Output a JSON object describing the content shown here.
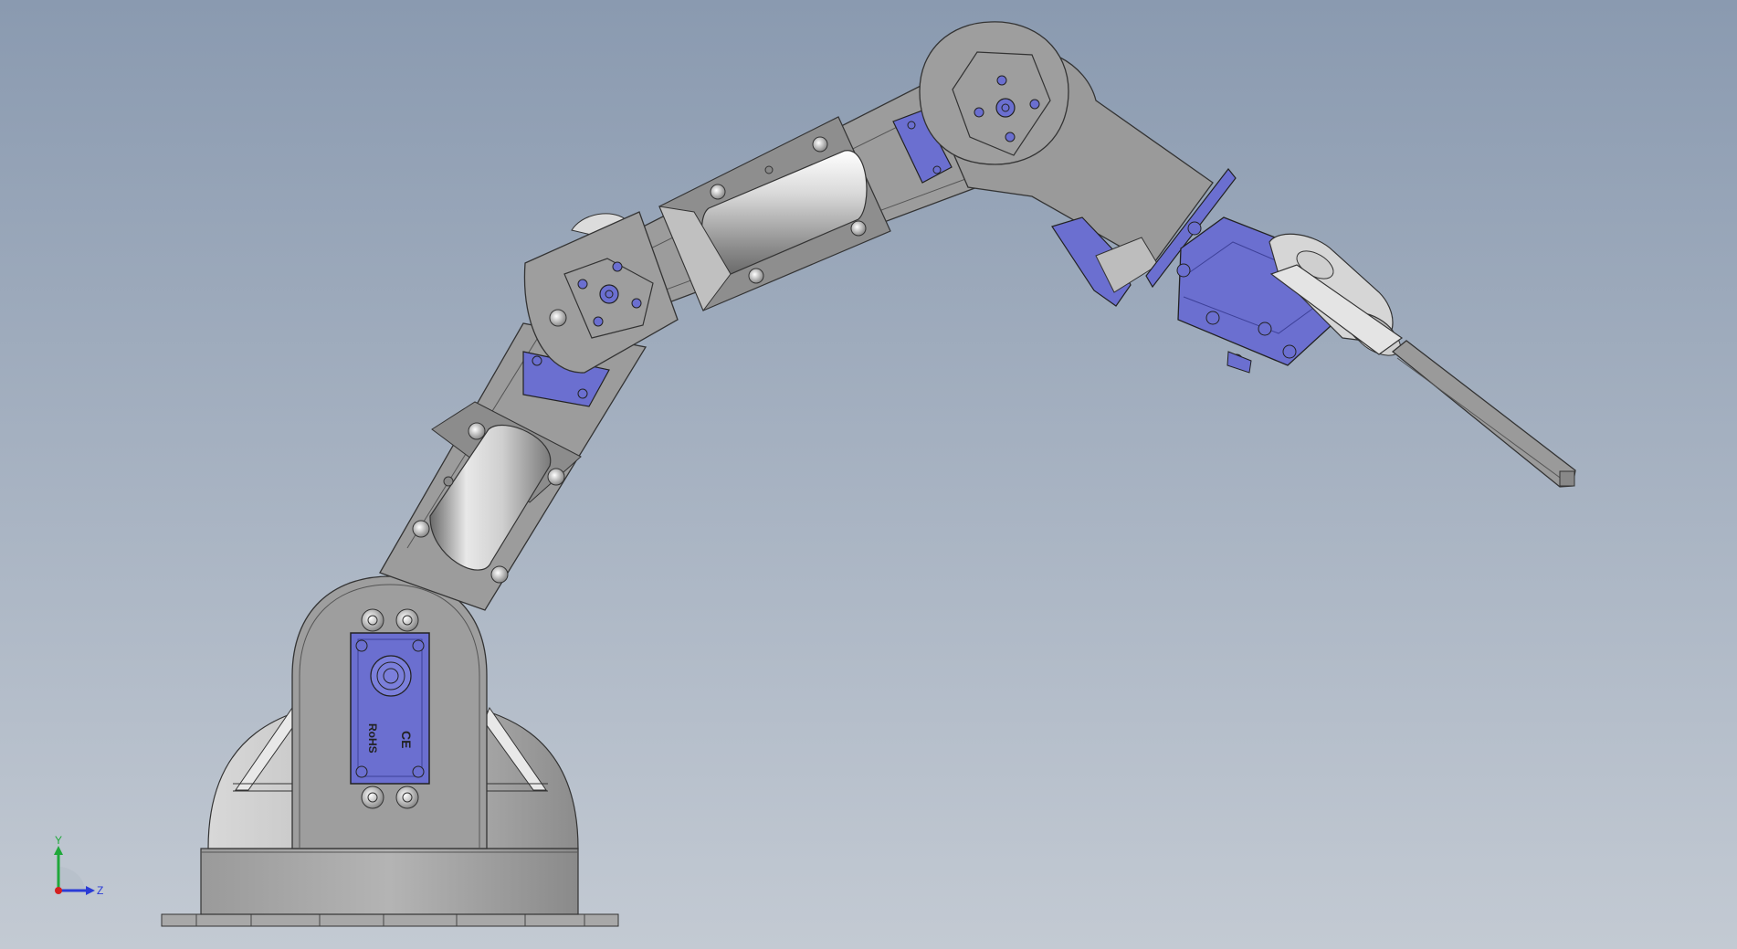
{
  "viewport": {
    "background_top": "#8a9ab0",
    "background_bottom": "#c3cad3"
  },
  "model": {
    "part_color": "#a5a5a5",
    "part_dark": "#6e6e6e",
    "servo_color": "#6b6fd0",
    "servo_dark": "#3e4199",
    "servo_marking_1": "CE",
    "servo_marking_2": "RoHS"
  },
  "triad": {
    "y_label": "Y",
    "z_label": "Z",
    "y_color": "#1fa83a",
    "z_color": "#2a3bd6",
    "x_color": "#d42020"
  }
}
